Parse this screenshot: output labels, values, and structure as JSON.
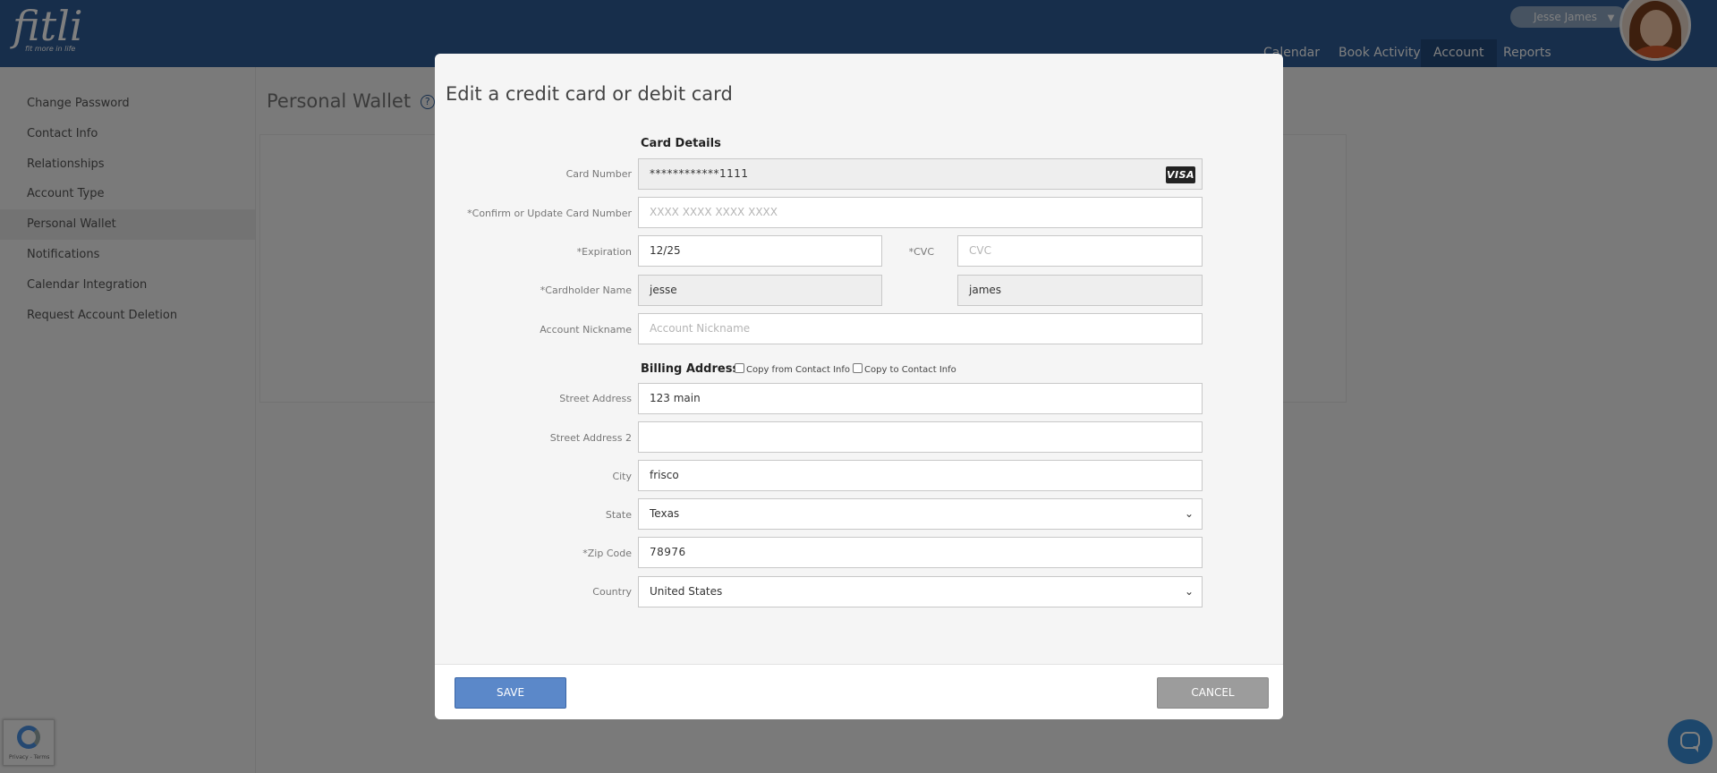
{
  "header": {
    "logo": "fitli",
    "tagline": "fit more in life",
    "user_name": "Jesse James",
    "user_caret": "▼",
    "nav": [
      "Calendar",
      "Book Activity",
      "Account",
      "Reports"
    ]
  },
  "sidebar": {
    "items": [
      "Change Password",
      "Contact Info",
      "Relationships",
      "Account Type",
      "Personal Wallet",
      "Notifications",
      "Calendar Integration",
      "Request Account Deletion"
    ]
  },
  "page": {
    "title": "Personal Wallet",
    "help": "?"
  },
  "modal": {
    "title": "Edit a credit card or debit card",
    "card_section": "Card Details",
    "labels": {
      "card_number": "Card Number",
      "confirm_card": "*Confirm or Update Card Number",
      "expiration": "*Expiration",
      "cvc": "*CVC",
      "cardholder": "*Cardholder Name",
      "nickname": "Account Nickname",
      "street": "Street Address",
      "street2": "Street Address 2",
      "city": "City",
      "state": "State",
      "zip": "*Zip Code",
      "country": "Country"
    },
    "values": {
      "card_number": "************1111",
      "card_brand": "VISA",
      "confirm_card": "",
      "expiration": "12/25",
      "cvc": "",
      "first_name": "jesse",
      "last_name": "james",
      "nickname": "",
      "street": "123 main",
      "street2": "",
      "city": "frisco",
      "state": "Texas",
      "zip": "78976",
      "country": "United States"
    },
    "placeholders": {
      "confirm_card": "XXXX XXXX XXXX XXXX",
      "cvc": "CVC",
      "nickname": "Account Nickname"
    },
    "billing_section": "Billing Address",
    "copy_from": "Copy from Contact Info",
    "copy_to": "Copy to Contact Info",
    "save_label": "SAVE",
    "cancel_label": "CANCEL"
  },
  "recaptcha_text": "Privacy - Terms",
  "colors": {
    "topbar": "#2e5c96",
    "save_button": "#5b88c9",
    "cancel_button": "#9c9c9c",
    "chat_button": "#3b8fd8"
  },
  "icons": [
    "help-icon",
    "visa-card-icon",
    "chevron-down-icon",
    "recaptcha-icon",
    "chat-icon",
    "avatar"
  ]
}
